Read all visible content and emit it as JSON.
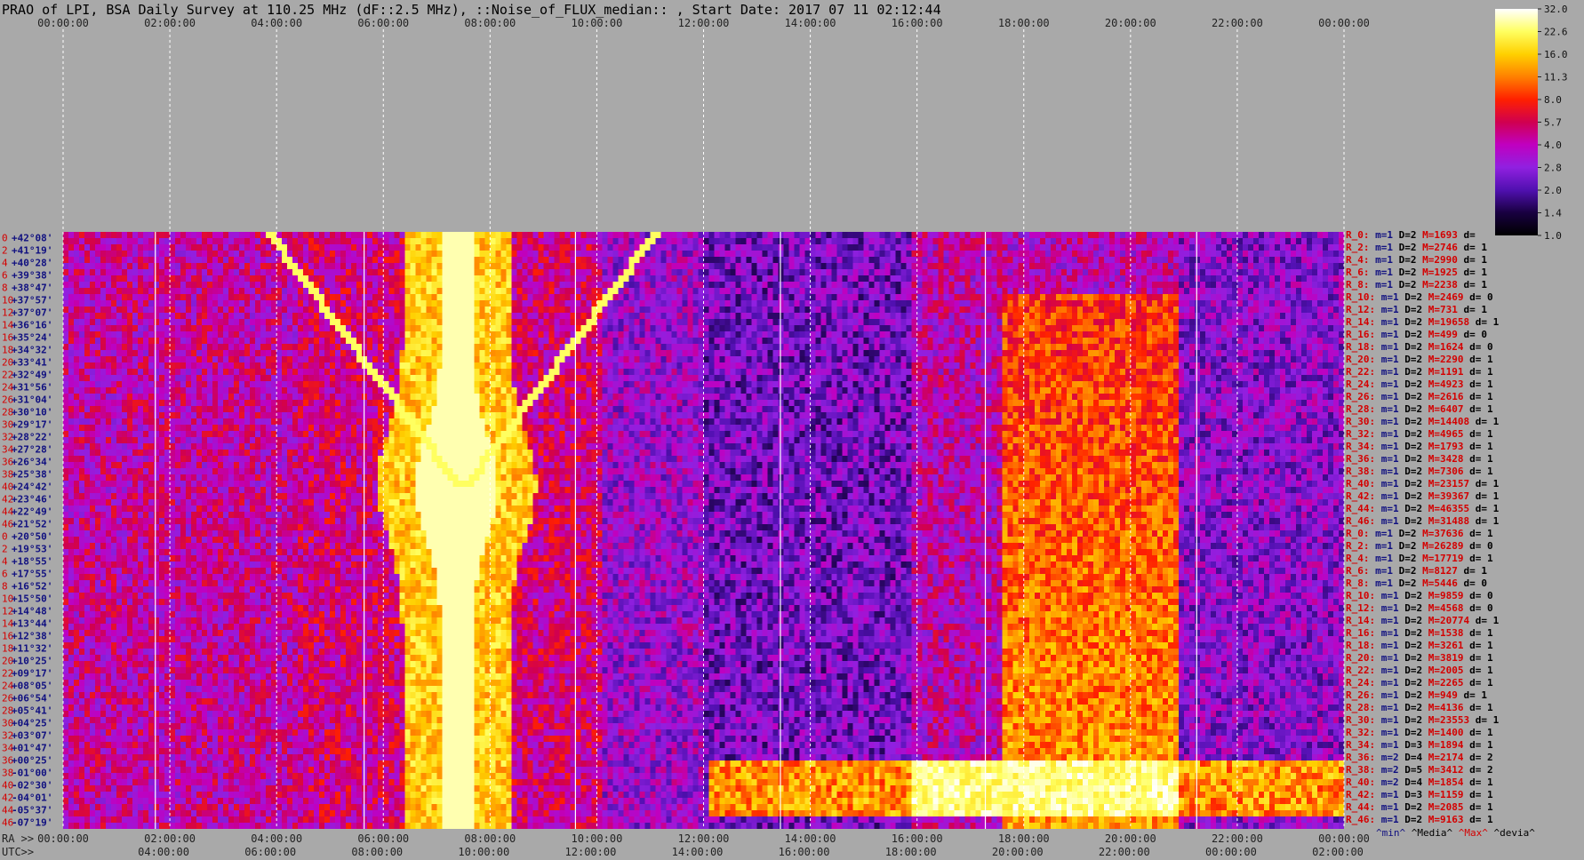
{
  "title": "PRAO of LPI, BSA Daily Survey at 110.25 MHz (dF::2.5 MHz), ::Noise_of_FLUX_median:: , Start Date: 2017 07 11 02:12:44",
  "chart_data": {
    "type": "heatmap",
    "title": "PRAO of LPI, BSA Daily Survey at 110.25 MHz (dF::2.5 MHz), ::Noise_of_FLUX_median:: , Start Date: 2017 07 11 02:12:44",
    "top_time_ticks": [
      "00:00:00",
      "02:00:00",
      "04:00:00",
      "06:00:00",
      "08:00:00",
      "10:00:00",
      "12:00:00",
      "14:00:00",
      "16:00:00",
      "18:00:00",
      "20:00:00",
      "22:00:00",
      "00:00:00"
    ],
    "ra_label": "RA >>",
    "ra_ticks": [
      "00:00:00",
      "02:00:00",
      "04:00:00",
      "06:00:00",
      "08:00:00",
      "10:00:00",
      "12:00:00",
      "14:00:00",
      "16:00:00",
      "18:00:00",
      "20:00:00",
      "22:00:00",
      "00:00:00"
    ],
    "utc_label": "UTC>>",
    "utc_ticks": [
      "04:00:00",
      "06:00:00",
      "08:00:00",
      "10:00:00",
      "12:00:00",
      "14:00:00",
      "16:00:00",
      "18:00:00",
      "20:00:00",
      "22:00:00",
      "00:00:00",
      "02:00:00"
    ],
    "colorbar_ticks": [
      "32.0",
      "22.6",
      "16.0",
      "11.3",
      "8.0",
      "5.7",
      "4.0",
      "2.8",
      "2.0",
      "1.4",
      "1.0"
    ],
    "colorbar_colors": [
      "#ffffff",
      "#ffff60",
      "#ffd000",
      "#ff8000",
      "#ff2000",
      "#d00050",
      "#c000c0",
      "#9020e0",
      "#5010b0",
      "#180040",
      "#000000"
    ],
    "declinations": [
      "+42°08'",
      "+41°19'",
      "+40°28'",
      "+39°38'",
      "+38°47'",
      "+37°57'",
      "+37°07'",
      "+36°16'",
      "+35°24'",
      "+34°32'",
      "+33°41'",
      "+32°49'",
      "+31°56'",
      "+31°04'",
      "+30°10'",
      "+29°17'",
      "+28°22'",
      "+27°28'",
      "+26°34'",
      "+25°38'",
      "+24°42'",
      "+23°46'",
      "+22°49'",
      "+21°52'",
      "+20°50'",
      "+19°53'",
      "+18°55'",
      "+17°55'",
      "+16°52'",
      "+15°50'",
      "+14°48'",
      "+13°44'",
      "+12°38'",
      "+11°32'",
      "+10°25'",
      "+09°17'",
      "+08°05'",
      "+06°54'",
      "+05°41'",
      "+04°25'",
      "+03°07'",
      "+01°47'",
      "+00°25'",
      "-01°00'",
      "-02°30'",
      "-04°01'",
      "-05°37'",
      "-07°19'"
    ],
    "row_numbers": [
      "0",
      "2",
      "4",
      "6",
      "8",
      "10",
      "12",
      "14",
      "16",
      "18",
      "20",
      "22",
      "24",
      "26",
      "28",
      "30",
      "32",
      "34",
      "36",
      "38",
      "40",
      "42",
      "44",
      "46",
      "0",
      "2",
      "4",
      "6",
      "8",
      "10",
      "12",
      "14",
      "16",
      "18",
      "20",
      "22",
      "24",
      "26",
      "28",
      "30",
      "32",
      "34",
      "36",
      "38",
      "40",
      "42",
      "44",
      "46"
    ],
    "right_rows": [
      [
        "R_0:",
        "m=1",
        "D=2",
        "M=1693",
        "d="
      ],
      [
        "R_2:",
        "m=1",
        "D=2",
        "M=2746",
        "d= 1"
      ],
      [
        "R_4:",
        "m=1",
        "D=2",
        "M=2990",
        "d= 1"
      ],
      [
        "R_6:",
        "m=1",
        "D=2",
        "M=1925",
        "d= 1"
      ],
      [
        "R_8:",
        "m=1",
        "D=2",
        "M=2238",
        "d= 1"
      ],
      [
        "R_10:",
        "m=1",
        "D=2",
        "M=2469",
        "d= 0"
      ],
      [
        "R_12:",
        "m=1",
        "D=2",
        "M=731",
        "d= 1"
      ],
      [
        "R_14:",
        "m=1",
        "D=2",
        "M=19658",
        "d= 1"
      ],
      [
        "R_16:",
        "m=1",
        "D=2",
        "M=499",
        "d= 0"
      ],
      [
        "R_18:",
        "m=1",
        "D=2",
        "M=1624",
        "d= 0"
      ],
      [
        "R_20:",
        "m=1",
        "D=2",
        "M=2290",
        "d= 1"
      ],
      [
        "R_22:",
        "m=1",
        "D=2",
        "M=1191",
        "d= 1"
      ],
      [
        "R_24:",
        "m=1",
        "D=2",
        "M=4923",
        "d= 1"
      ],
      [
        "R_26:",
        "m=1",
        "D=2",
        "M=2616",
        "d= 1"
      ],
      [
        "R_28:",
        "m=1",
        "D=2",
        "M=6407",
        "d= 1"
      ],
      [
        "R_30:",
        "m=1",
        "D=2",
        "M=14408",
        "d= 1"
      ],
      [
        "R_32:",
        "m=1",
        "D=2",
        "M=4965",
        "d= 1"
      ],
      [
        "R_34:",
        "m=1",
        "D=2",
        "M=1793",
        "d= 1"
      ],
      [
        "R_36:",
        "m=1",
        "D=2",
        "M=3428",
        "d= 1"
      ],
      [
        "R_38:",
        "m=1",
        "D=2",
        "M=7306",
        "d= 1"
      ],
      [
        "R_40:",
        "m=1",
        "D=2",
        "M=23157",
        "d= 1"
      ],
      [
        "R_42:",
        "m=1",
        "D=2",
        "M=39367",
        "d= 1"
      ],
      [
        "R_44:",
        "m=1",
        "D=2",
        "M=46355",
        "d= 1"
      ],
      [
        "R_46:",
        "m=1",
        "D=2",
        "M=31488",
        "d= 1"
      ],
      [
        "R_0:",
        "m=1",
        "D=2",
        "M=37636",
        "d= 1"
      ],
      [
        "R_2:",
        "m=1",
        "D=2",
        "M=26289",
        "d= 0"
      ],
      [
        "R_4:",
        "m=1",
        "D=2",
        "M=17719",
        "d= 1"
      ],
      [
        "R_6:",
        "m=1",
        "D=2",
        "M=8127",
        "d= 1"
      ],
      [
        "R_8:",
        "m=1",
        "D=2",
        "M=5446",
        "d= 0"
      ],
      [
        "R_10:",
        "m=1",
        "D=2",
        "M=9859",
        "d= 0"
      ],
      [
        "R_12:",
        "m=1",
        "D=2",
        "M=4568",
        "d= 0"
      ],
      [
        "R_14:",
        "m=1",
        "D=2",
        "M=20774",
        "d= 1"
      ],
      [
        "R_16:",
        "m=1",
        "D=2",
        "M=1538",
        "d= 1"
      ],
      [
        "R_18:",
        "m=1",
        "D=2",
        "M=3261",
        "d= 1"
      ],
      [
        "R_20:",
        "m=1",
        "D=2",
        "M=3819",
        "d= 1"
      ],
      [
        "R_22:",
        "m=1",
        "D=2",
        "M=2005",
        "d= 1"
      ],
      [
        "R_24:",
        "m=1",
        "D=2",
        "M=2265",
        "d= 1"
      ],
      [
        "R_26:",
        "m=1",
        "D=2",
        "M=949",
        "d= 1"
      ],
      [
        "R_28:",
        "m=1",
        "D=2",
        "M=4136",
        "d= 1"
      ],
      [
        "R_30:",
        "m=1",
        "D=2",
        "M=23553",
        "d= 1"
      ],
      [
        "R_32:",
        "m=1",
        "D=2",
        "M=1400",
        "d= 1"
      ],
      [
        "R_34:",
        "m=1",
        "D=3",
        "M=1894",
        "d= 1"
      ],
      [
        "R_36:",
        "m=2",
        "D=4",
        "M=2174",
        "d= 2"
      ],
      [
        "R_38:",
        "m=2",
        "D=5",
        "M=3412",
        "d= 2"
      ],
      [
        "R_40:",
        "m=2",
        "D=4",
        "M=1854",
        "d= 1"
      ],
      [
        "R_42:",
        "m=1",
        "D=3",
        "M=1159",
        "d= 1"
      ],
      [
        "R_44:",
        "m=1",
        "D=2",
        "M=2085",
        "d= 1"
      ],
      [
        "R_46:",
        "m=1",
        "D=2",
        "M=9163",
        "d= 1"
      ]
    ],
    "legend_keys": [
      "^min^",
      "^Media^",
      "^Max^",
      "^devia^"
    ]
  }
}
